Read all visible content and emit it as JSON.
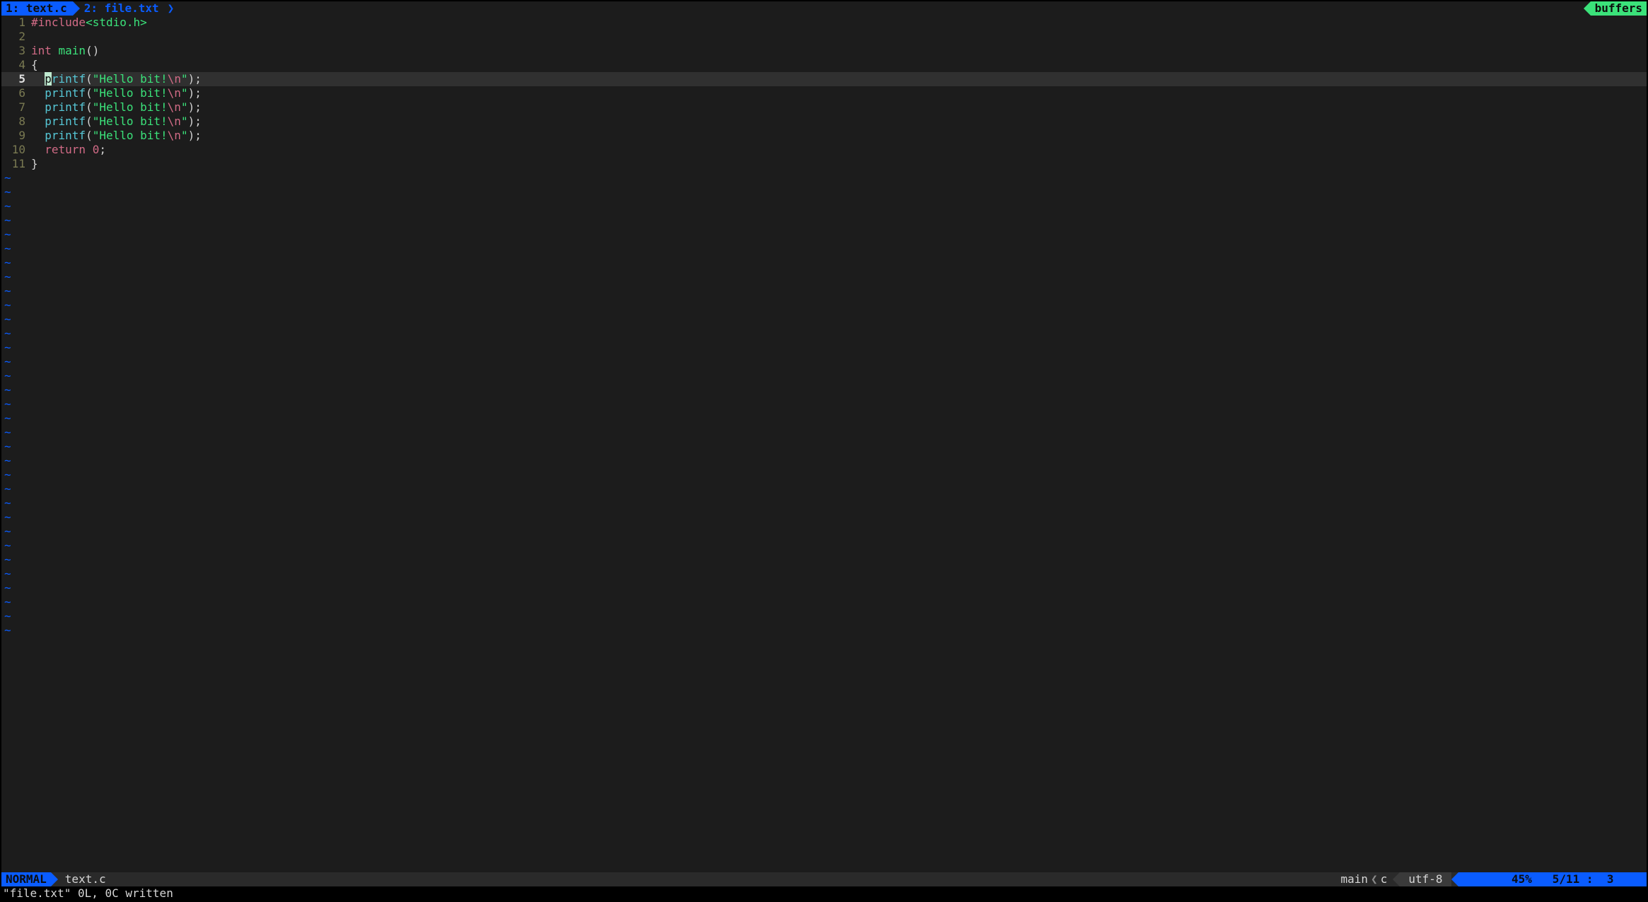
{
  "tabs": {
    "active": {
      "index": "1",
      "name": "text.c"
    },
    "inactive": {
      "index": "2",
      "name": "file.txt"
    },
    "buffers_label": "buffers"
  },
  "code": {
    "cursor_line": 5,
    "cursor_col_char": "p",
    "lines": [
      {
        "n": 1,
        "tokens": [
          [
            "pre",
            "#include"
          ],
          [
            "inc",
            "<stdio.h>"
          ]
        ]
      },
      {
        "n": 2,
        "tokens": []
      },
      {
        "n": 3,
        "tokens": [
          [
            "type",
            "int "
          ],
          [
            "func",
            "main"
          ],
          [
            "punc",
            "()"
          ]
        ]
      },
      {
        "n": 4,
        "tokens": [
          [
            "plain",
            "{"
          ]
        ]
      },
      {
        "n": 5,
        "tokens": [
          [
            "plain",
            "  "
          ],
          [
            "cursor",
            "p"
          ],
          [
            "call",
            "rintf"
          ],
          [
            "punc",
            "("
          ],
          [
            "str",
            "\"Hello bit!"
          ],
          [
            "esc",
            "\\n"
          ],
          [
            "str",
            "\""
          ],
          [
            "punc",
            ");"
          ]
        ]
      },
      {
        "n": 6,
        "tokens": [
          [
            "plain",
            "  "
          ],
          [
            "call",
            "printf"
          ],
          [
            "punc",
            "("
          ],
          [
            "str",
            "\"Hello bit!"
          ],
          [
            "esc",
            "\\n"
          ],
          [
            "str",
            "\""
          ],
          [
            "punc",
            ");"
          ]
        ]
      },
      {
        "n": 7,
        "tokens": [
          [
            "plain",
            "  "
          ],
          [
            "call",
            "printf"
          ],
          [
            "punc",
            "("
          ],
          [
            "str",
            "\"Hello bit!"
          ],
          [
            "esc",
            "\\n"
          ],
          [
            "str",
            "\""
          ],
          [
            "punc",
            ");"
          ]
        ]
      },
      {
        "n": 8,
        "tokens": [
          [
            "plain",
            "  "
          ],
          [
            "call",
            "printf"
          ],
          [
            "punc",
            "("
          ],
          [
            "str",
            "\"Hello bit!"
          ],
          [
            "esc",
            "\\n"
          ],
          [
            "str",
            "\""
          ],
          [
            "punc",
            ");"
          ]
        ]
      },
      {
        "n": 9,
        "tokens": [
          [
            "plain",
            "  "
          ],
          [
            "call",
            "printf"
          ],
          [
            "punc",
            "("
          ],
          [
            "str",
            "\"Hello bit!"
          ],
          [
            "esc",
            "\\n"
          ],
          [
            "str",
            "\""
          ],
          [
            "punc",
            ");"
          ]
        ]
      },
      {
        "n": 10,
        "tokens": [
          [
            "plain",
            "  "
          ],
          [
            "pre",
            "return "
          ],
          [
            "num",
            "0"
          ],
          [
            "punc",
            ";"
          ]
        ]
      },
      {
        "n": 11,
        "tokens": [
          [
            "plain",
            "}"
          ]
        ]
      }
    ],
    "tilde_rows": 33
  },
  "status": {
    "mode": "NORMAL",
    "file": "text.c",
    "branch": "main",
    "filetype": "c",
    "encoding": "utf-8",
    "percent": "45%",
    "line_total": "5/11",
    "col": "3"
  },
  "message": "\"file.txt\" 0L, 0C written"
}
